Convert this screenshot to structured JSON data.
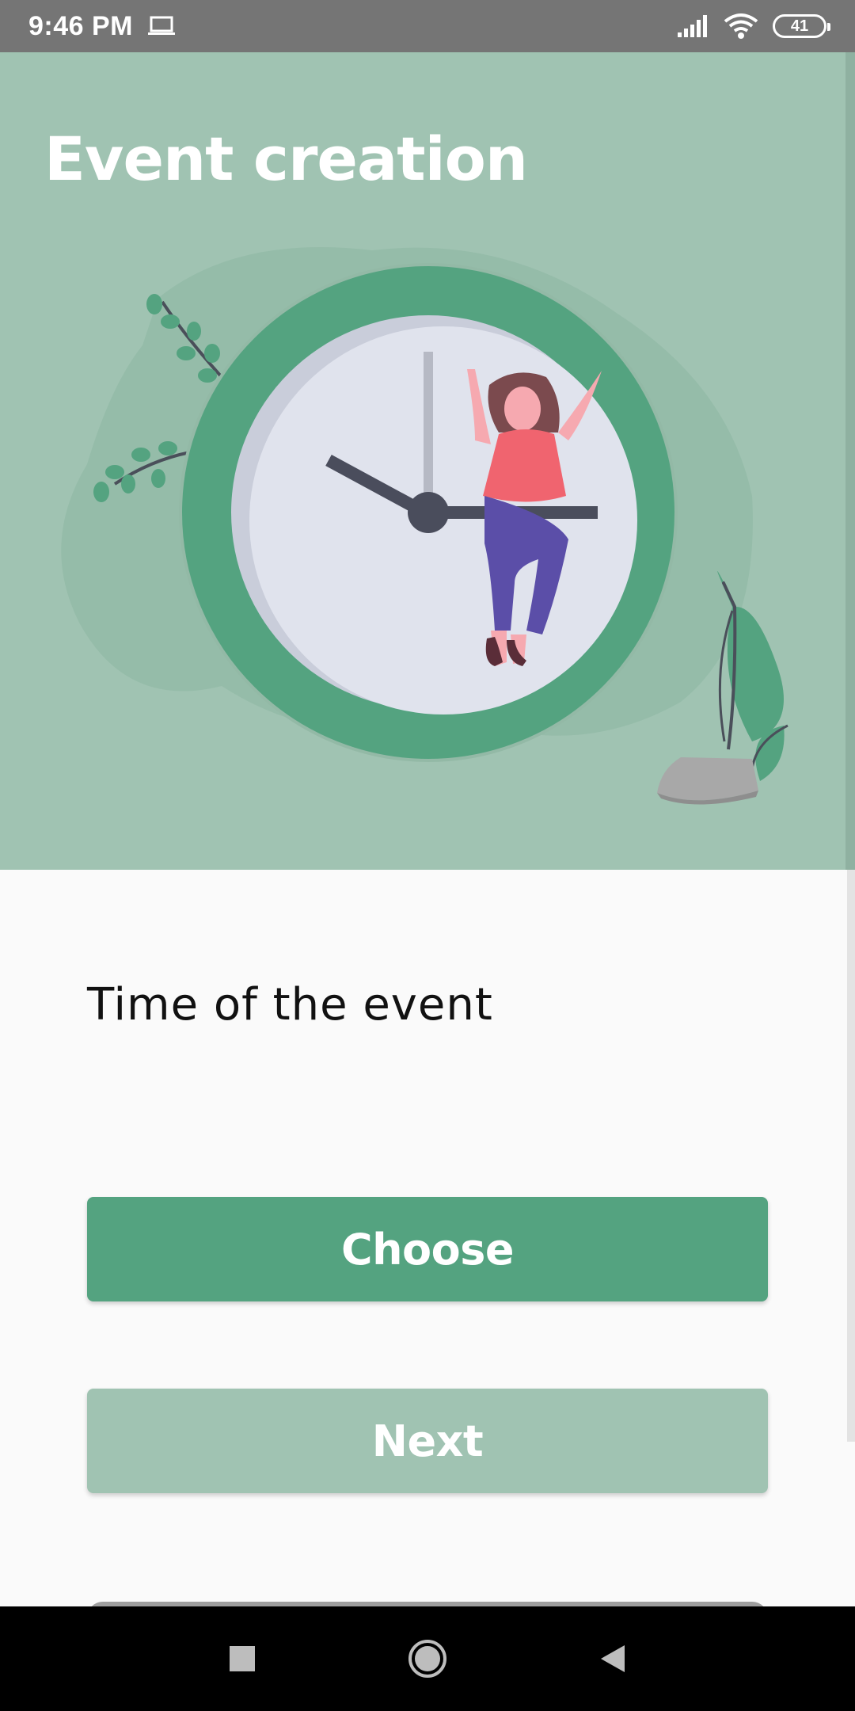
{
  "status_bar": {
    "time": "9:46 PM",
    "battery": "41",
    "icons": [
      "laptop-icon",
      "signal-icon",
      "wifi-icon",
      "battery-icon"
    ]
  },
  "hero": {
    "title": "Event creation",
    "illustration": "clock-with-woman-illustration"
  },
  "form": {
    "label": "Time of the event",
    "choose_label": "Choose",
    "next_label": "Next"
  },
  "nav": {
    "icons": [
      "recents-square-icon",
      "home-circle-icon",
      "back-triangle-icon"
    ]
  },
  "colors": {
    "hero_bg": "#a0c3b2",
    "primary": "#54a380",
    "status_bar": "#757575",
    "nav_bar": "#000000"
  }
}
